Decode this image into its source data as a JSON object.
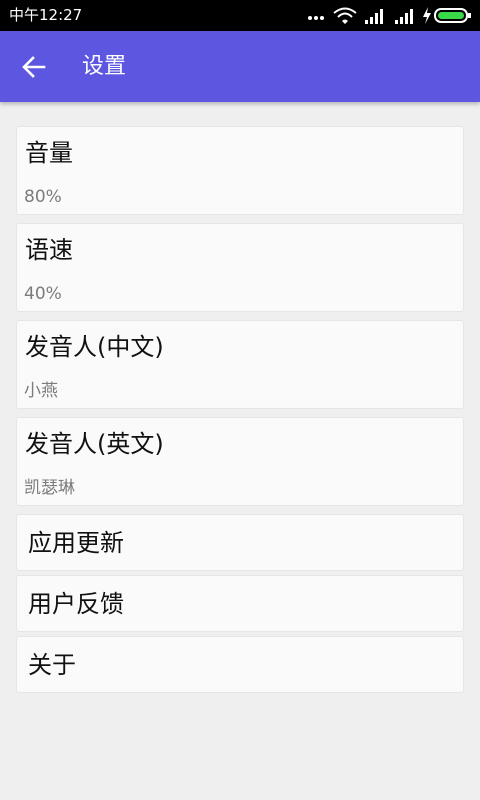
{
  "status_bar": {
    "time": "中午12:27",
    "icons": [
      "more-icon",
      "wifi-icon",
      "signal-icon",
      "signal-icon",
      "charging-icon",
      "battery-icon"
    ]
  },
  "app_bar": {
    "back_icon": "back-arrow-icon",
    "title": "设置",
    "color": "#5c56e0"
  },
  "settings": {
    "items": [
      {
        "title": "音量",
        "value": "80%"
      },
      {
        "title": "语速",
        "value": "40%"
      },
      {
        "title": "发音人(中文)",
        "value": "小燕"
      },
      {
        "title": "发音人(英文)",
        "value": "凯瑟琳"
      },
      {
        "title": "应用更新"
      },
      {
        "title": "用户反馈"
      },
      {
        "title": "关于"
      }
    ]
  }
}
